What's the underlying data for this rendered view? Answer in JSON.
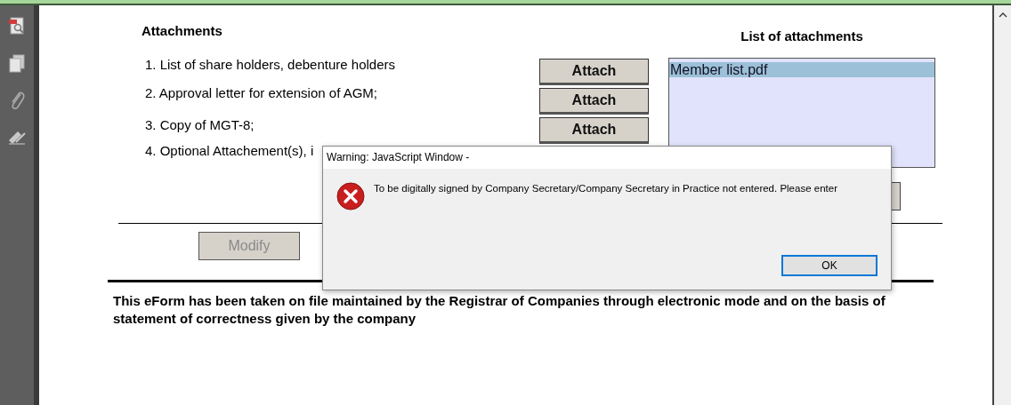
{
  "form": {
    "heading": "Attachments",
    "list_heading": "List of attachments",
    "items": [
      {
        "text": "1. List of share holders, debenture holders",
        "button": "Attach"
      },
      {
        "text": "2. Approval letter for extension of AGM;",
        "button": "Attach"
      },
      {
        "text": "3. Copy of MGT-8;",
        "button": "Attach"
      },
      {
        "text": "4. Optional Attachement(s), i"
      }
    ],
    "attachments": [
      {
        "name": "Member list.pdf",
        "selected": true
      }
    ],
    "modify_button": {
      "label": "Modify",
      "disabled": true
    },
    "notice": "This eForm has been taken on file maintained by the Registrar of Companies through electronic mode and on the basis of statement of correctness given by the company"
  },
  "dialog": {
    "title": "Warning: JavaScript Window -",
    "message": "To be digitally signed by Company Secretary/Company Secretary in Practice not entered. Please enter",
    "ok_button": "OK"
  }
}
